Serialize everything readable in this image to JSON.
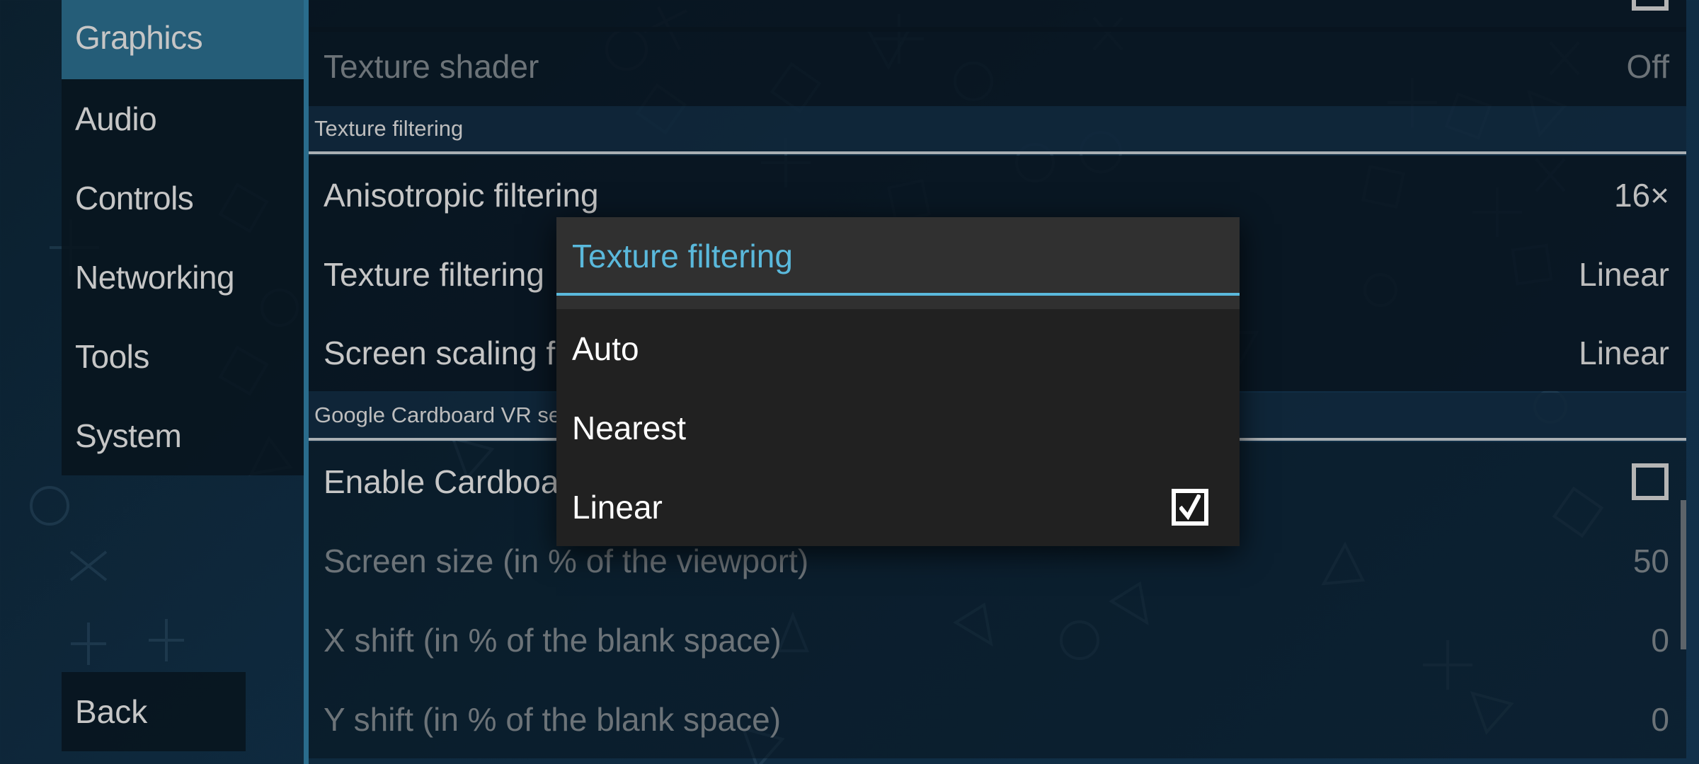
{
  "colors": {
    "accent": "#5ab9dc",
    "sidebar_active": "#255d78",
    "content_divider": "#2a6c8c"
  },
  "sidebar": {
    "items": [
      {
        "label": "Graphics",
        "active": true
      },
      {
        "label": "Audio",
        "active": false
      },
      {
        "label": "Controls",
        "active": false
      },
      {
        "label": "Networking",
        "active": false
      },
      {
        "label": "Tools",
        "active": false
      },
      {
        "label": "System",
        "active": false
      }
    ],
    "back_label": "Back"
  },
  "settings": {
    "top_row": {
      "checked": false
    },
    "texture_shader": {
      "label": "Texture shader",
      "value": "Off"
    },
    "section_texture_filtering": {
      "title": "Texture filtering"
    },
    "anisotropic_filtering": {
      "label": "Anisotropic filtering",
      "value": "16×"
    },
    "texture_filtering": {
      "label": "Texture filtering",
      "value": "Linear"
    },
    "screen_scaling_filter": {
      "label": "Screen scaling filter",
      "value": "Linear"
    },
    "section_cardboard": {
      "title": "Google Cardboard VR settings"
    },
    "enable_cardboard": {
      "label": "Enable Cardboard VR",
      "checked": false
    },
    "screen_size": {
      "label": "Screen size (in % of the viewport)",
      "value": "50"
    },
    "x_shift": {
      "label": "X shift (in % of the blank space)",
      "value": "0"
    },
    "y_shift": {
      "label": "Y shift (in % of the blank space)",
      "value": "0"
    }
  },
  "dialog": {
    "title": "Texture filtering",
    "options": [
      {
        "label": "Auto",
        "selected": false
      },
      {
        "label": "Nearest",
        "selected": false
      },
      {
        "label": "Linear",
        "selected": true
      }
    ]
  }
}
